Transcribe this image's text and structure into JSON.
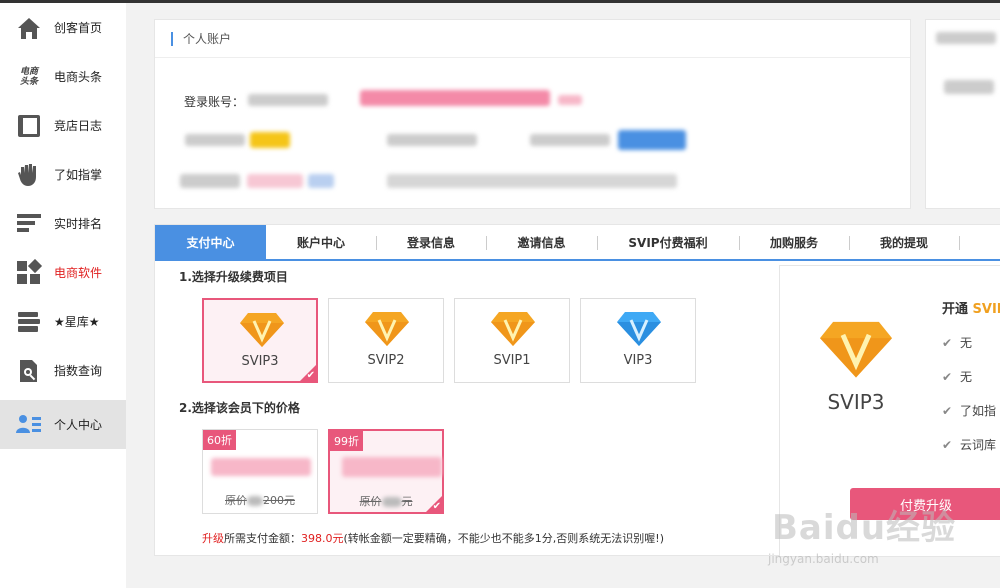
{
  "sidebar": {
    "items": [
      {
        "label": "创客首页",
        "icon": "home-icon"
      },
      {
        "label": "电商头条",
        "icon": "headline-logo-icon"
      },
      {
        "label": "竞店日志",
        "icon": "book-icon"
      },
      {
        "label": "了如指掌",
        "icon": "hand-icon"
      },
      {
        "label": "实时排名",
        "icon": "ranking-bars-icon"
      },
      {
        "label": "电商软件",
        "icon": "apps-grid-icon"
      },
      {
        "label": "★星库★",
        "icon": "stack-cards-icon"
      },
      {
        "label": "指数查询",
        "icon": "document-search-icon"
      },
      {
        "label": "个人中心",
        "icon": "user-list-icon"
      }
    ],
    "headline_logo_text": "电商头条"
  },
  "account": {
    "title": "个人账户",
    "login_label": "登录账号："
  },
  "tabs": [
    "支付中心",
    "账户中心",
    "登录信息",
    "邀请信息",
    "SVIP付费福利",
    "加购服务",
    "我的提现"
  ],
  "upgrade": {
    "section1_title": "1.选择升级续费项目",
    "items": [
      "SVIP3",
      "SVIP2",
      "SVIP1",
      "VIP3"
    ],
    "section2_title": "2.选择该会员下的价格",
    "prices": [
      {
        "badge": "60折",
        "orig_a": "原价",
        "orig_b": "200元"
      },
      {
        "badge": "99折",
        "orig_a": "原价",
        "orig_b": "元"
      }
    ],
    "note_prefix": "升级",
    "note_mid": "所需支付金额：",
    "note_amount": "398.0元",
    "note_suffix": "(转帐金额一定要精确，不能少也不能多1分,否则系统无法识别喔!)"
  },
  "preview": {
    "label": "SVIP3",
    "kaitong": "开通",
    "kaitong_gold": "SVIF",
    "perks": [
      "无",
      "无",
      "了如指",
      "云词库"
    ],
    "pay_button": "付费升级"
  },
  "watermark": {
    "text": "Baidu经验",
    "url": "jingyan.baidu.com"
  },
  "colors": {
    "accent": "#4a90e2",
    "pink": "#e8577b",
    "gold": "#f0a020",
    "red": "#e02020"
  }
}
